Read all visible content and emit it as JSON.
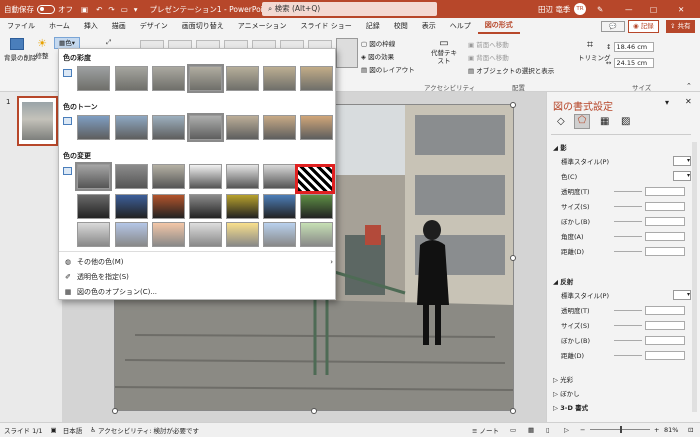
{
  "titlebar": {
    "autosave_label": "自動保存",
    "autosave_state": "オフ",
    "doc_title": "プレゼンテーション1 - PowerPoint",
    "search_placeholder": "検索 (Alt+Q)",
    "user_name": "田辺 竜季",
    "user_initials": "TR"
  },
  "tabs": [
    "ファイル",
    "ホーム",
    "挿入",
    "描画",
    "デザイン",
    "画面切り替え",
    "アニメーション",
    "スライド ショー",
    "記録",
    "校閲",
    "表示",
    "ヘルプ",
    "図の形式"
  ],
  "active_tab": "図の形式",
  "ribbon_right": {
    "record_label": "記録",
    "share_label": "共有"
  },
  "ribbon": {
    "remove_bg": "背景の削除",
    "correct": "修整",
    "color": "色",
    "border": "図の枠線",
    "effects": "図の効果",
    "layout": "図のレイアウト",
    "alt_text": "代替テキスト",
    "accessibility_group": "アクセシビリティ",
    "bring_forward": "前面へ移動",
    "send_backward": "背面へ移動",
    "selection_pane": "オブジェクトの選択と表示",
    "arrange_group": "配置",
    "crop": "トリミング",
    "height": "18.46 cm",
    "width": "24.15 cm",
    "size_group": "サイズ"
  },
  "dropdown": {
    "saturation_header": "色の彩度",
    "tone_header": "色のトーン",
    "recolor_header": "色の変更",
    "more_colors": "その他の色(M)",
    "set_transparent": "透明色を指定(S)",
    "color_options": "図の色のオプション(C)..."
  },
  "slide_panel": {
    "slide_number": "1"
  },
  "format_pane": {
    "title": "図の書式設定",
    "shadow_section": "影",
    "shadow_rows": [
      "標準スタイル(P)",
      "色(C)",
      "透明度(T)",
      "サイズ(S)",
      "ぼかし(B)",
      "角度(A)",
      "距離(D)"
    ],
    "reflection_section": "反射",
    "reflection_rows": [
      "標準スタイル(P)",
      "透明度(T)",
      "サイズ(S)",
      "ぼかし(B)",
      "距離(D)"
    ],
    "glow_section": "光彩",
    "soft_edges_section": "ぼかし",
    "threed_section": "3-D 書式"
  },
  "statusbar": {
    "slide_info": "スライド 1/1",
    "language": "日本語",
    "accessibility": "アクセシビリティ: 検討が必要です",
    "notes": "ノート",
    "zoom": "81%"
  },
  "colors": {
    "accent": "#b7472a",
    "highlight_box": "#e02020"
  }
}
